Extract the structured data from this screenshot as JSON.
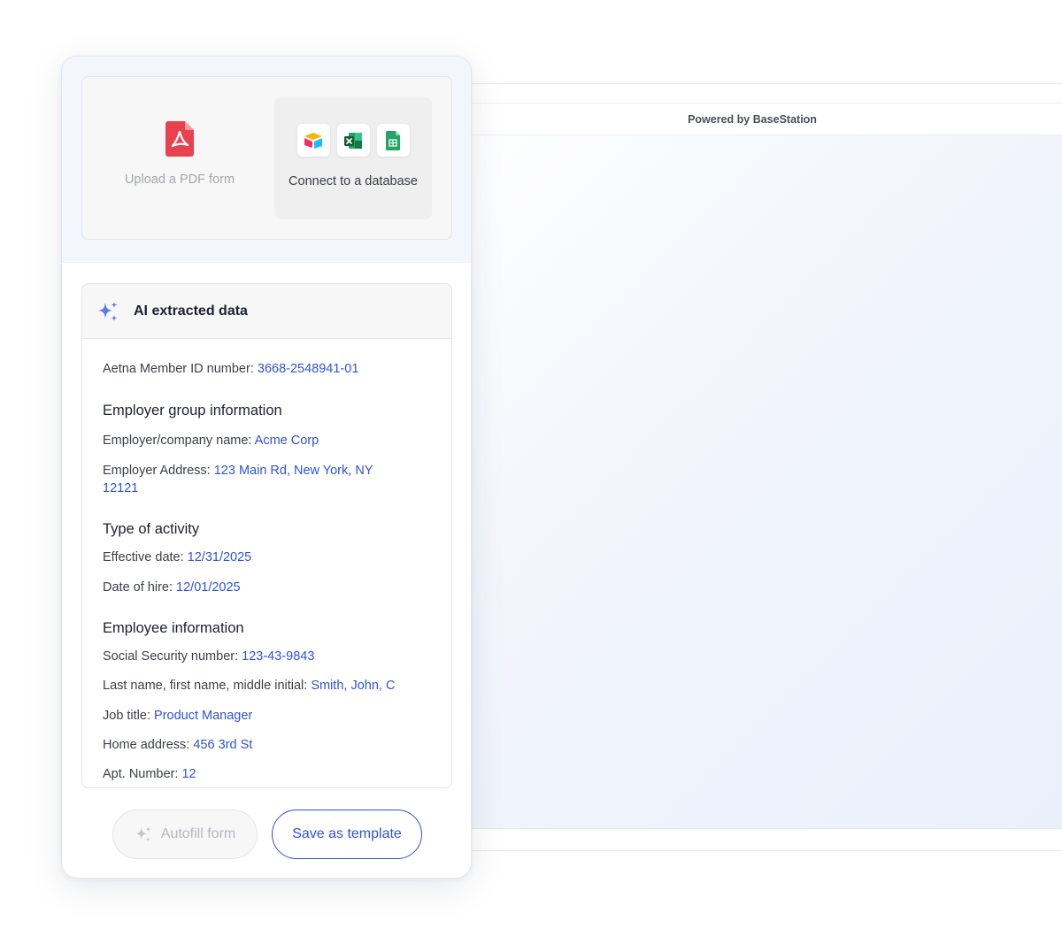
{
  "preview": {
    "powered_by": "Powered by BaseStation"
  },
  "sources": {
    "upload_label": "Upload a PDF form",
    "database_label": "Connect to a database",
    "database_icons": [
      "airtable-icon",
      "excel-icon",
      "google-sheets-icon"
    ]
  },
  "ai_panel": {
    "title": "AI extracted data",
    "member_id": {
      "label": "Aetna Member ID number:",
      "value": "3668-2548941-01"
    },
    "employer_section": "Employer group information",
    "employer_name": {
      "label": "Employer/company name:",
      "value": "Acme Corp"
    },
    "employer_address": {
      "label": "Employer Address:",
      "value": "123 Main Rd, New York, NY 12121"
    },
    "activity_section": "Type of activity",
    "effective_date": {
      "label": "Effective date:",
      "value": "12/31/2025"
    },
    "hire_date": {
      "label": "Date of hire:",
      "value": "12/01/2025"
    },
    "employee_section": "Employee information",
    "ssn": {
      "label": "Social Security number:",
      "value": "123-43-9843"
    },
    "full_name": {
      "label": "Last name, first name, middle initial:",
      "value": "Smith, John, C"
    },
    "job_title": {
      "label": "Job title:",
      "value": "Product Manager"
    },
    "home_address": {
      "label": "Home address:",
      "value": "456 3rd St"
    },
    "apt_number": {
      "label": "Apt. Number:",
      "value": "12"
    }
  },
  "buttons": {
    "autofill": "Autofill form",
    "save_template": "Save as template"
  },
  "colors": {
    "accent": "#2f53d9",
    "pdf_red": "#e9424f",
    "sparkle": "#5b7be8"
  }
}
